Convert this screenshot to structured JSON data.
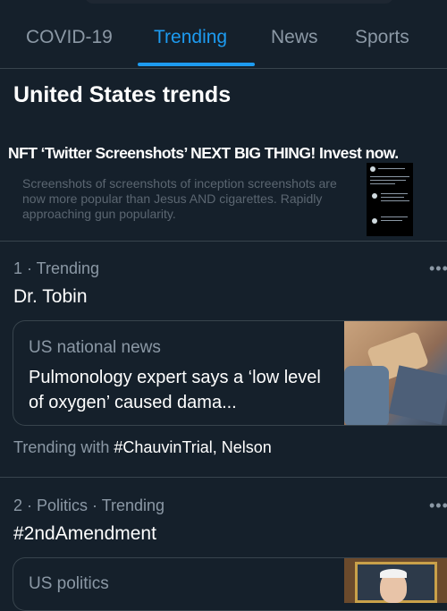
{
  "tabs": [
    "COVID-19",
    "Trending",
    "News",
    "Sports"
  ],
  "section_title": "United States trends",
  "promo": {
    "headline": "NFT ‘Twitter Screenshots’ NEXT BIG THING! Invest now.",
    "body": "Screenshots of screenshots of inception screenshots are now more popular than Jesus AND cigarettes. Rapidly approaching gun popularity."
  },
  "trends": [
    {
      "meta": "1 · Trending",
      "name": "Dr. Tobin",
      "more": "•••",
      "card": {
        "source": "US national news",
        "headline": "Pulmonology expert says a ‘low level of oxygen’ caused dama..."
      },
      "context_prefix": "Trending with ",
      "context_highlight": "#ChauvinTrial, Nelson"
    },
    {
      "meta": "2 · Politics · Trending",
      "name": "#2ndAmendment",
      "more": "•••",
      "card": {
        "source": "US politics"
      }
    }
  ],
  "colors": {
    "background": "#15202b",
    "accent": "#1d9bf0",
    "secondary_text": "#8b98a5",
    "border": "#38444d"
  }
}
